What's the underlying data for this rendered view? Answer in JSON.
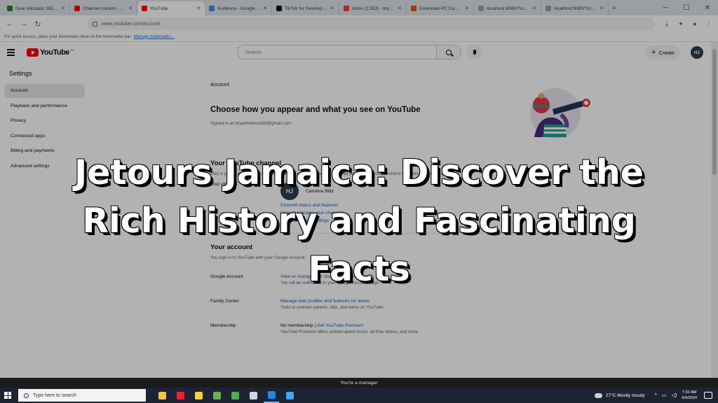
{
  "browser": {
    "tabs": [
      {
        "title": "Gear Allocator 365 Ultra",
        "favicon_color": "#2e7d32",
        "active": false
      },
      {
        "title": "Channel content - YouTube Studio",
        "favicon_color": "#ff0000",
        "active": false
      },
      {
        "title": "YouTube",
        "favicon_color": "#ff0000",
        "active": true
      },
      {
        "title": "Audience - Google Analytics",
        "favicon_color": "#4285f4",
        "active": false
      },
      {
        "title": "TikTok for Developers",
        "favicon_color": "#000000",
        "active": false
      },
      {
        "title": "Inbox (2,553) - bryanmi",
        "favicon_color": "#ea4335",
        "active": false
      },
      {
        "title": "Download PC Game Full",
        "favicon_color": "#e65100",
        "active": false
      },
      {
        "title": "localhost:8080/?state=1ff4D",
        "favicon_color": "#9e9e9e",
        "active": false
      },
      {
        "title": "localhost:8080/?state=dh8C",
        "favicon_color": "#9e9e9e",
        "active": false
      }
    ],
    "url": "www.youtube.com/account",
    "bookmarks_text": "For quick access, place your bookmarks here on the bookmarks bar.",
    "bookmarks_link": "Manage bookmarks..."
  },
  "youtube": {
    "logo_text": "YouTube",
    "country_code": "JM",
    "search_placeholder": "Search",
    "create_label": "Create",
    "avatar_initials": "HJ"
  },
  "sidebar": {
    "heading": "Settings",
    "items": [
      {
        "label": "Account",
        "active": true
      },
      {
        "label": "Playback and performance",
        "active": false
      },
      {
        "label": "Privacy",
        "active": false
      },
      {
        "label": "Connected apps",
        "active": false
      },
      {
        "label": "Billing and payments",
        "active": false
      },
      {
        "label": "Advanced settings",
        "active": false
      }
    ]
  },
  "main": {
    "section_label": "Account",
    "heading": "Choose how you appear and what you see on YouTube",
    "signed_in": "Signed in as bryanmilwood26@gmail.com",
    "channel_section": {
      "title": "Your YouTube channel",
      "description": "This is your public presence on YouTube. You need a channel to upload your own videos, comment on videos, or create playlists.",
      "channel_label": "Your channel",
      "channel_initials": "HJ",
      "channel_name": "Carolina Blitz",
      "link_status": "Channel status and features",
      "link_manage": "View or manage your channels",
      "link_advanced": "View advanced settings"
    },
    "account_section": {
      "title": "Your account",
      "description": "You sign in to YouTube with your Google Account",
      "rows": [
        {
          "label": "Google Account",
          "link": "View or change your Google Account settings",
          "hint": "You will be redirected to your Google Account page"
        },
        {
          "label": "Family Center",
          "link": "Manage kids profiles and features for teens",
          "hint": "Tools to connect parents, kids, and teens on YouTube"
        },
        {
          "label": "Membership",
          "link_prefix": "No membership |",
          "link": "Get YouTube Premium",
          "hint": "YouTube Premium offers uninterrupted music, ad-free videos, and more"
        }
      ]
    }
  },
  "overlay": {
    "title": "Jetours Jamaica: Discover the Rich History and Fascinating Facts"
  },
  "manager_bar": "You're a manager",
  "taskbar": {
    "search_placeholder": "Type here to search",
    "apps": [
      {
        "name": "file-explorer",
        "color": "#f4c542"
      },
      {
        "name": "opera",
        "color": "#ff1b2d"
      },
      {
        "name": "sticky-notes",
        "color": "#f7d23b"
      },
      {
        "name": "photo-app",
        "color": "#6ab04c"
      },
      {
        "name": "maps-app",
        "color": "#4caf50"
      },
      {
        "name": "text-app",
        "color": "#cfd8dc"
      },
      {
        "name": "edge-browser",
        "color": "#1e88e5"
      },
      {
        "name": "globe-app",
        "color": "#42a5f5"
      }
    ],
    "weather": "27°C  Mostly cloudy",
    "time": "7:32 AM",
    "date": "6/6/2024"
  },
  "colors": {
    "youtube_red": "#ff0000",
    "link_blue": "#065fd4",
    "taskbar_bg": "#1c2433"
  }
}
